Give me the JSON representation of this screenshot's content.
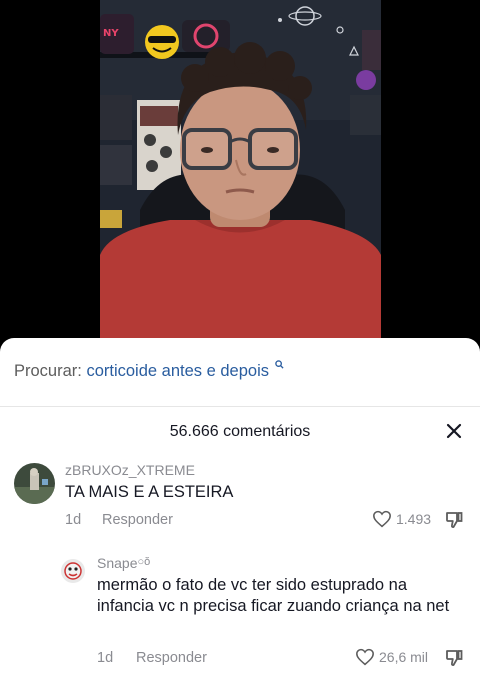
{
  "search": {
    "prefix": "Procurar:",
    "query": "corticoide antes e depois"
  },
  "comments_panel": {
    "count_label": "56.666 comentários"
  },
  "comments": [
    {
      "username": "zBRUXOz_XTREME",
      "text": "TA MAIS E A ESTEIRA",
      "time": "1d",
      "reply_label": "Responder",
      "likes": "1.493"
    },
    {
      "username": "Snape",
      "username_suffix": "○ŏ",
      "text": "mermão o fato de vc ter sido estuprado na infancia vc n precisa ficar zuando criança na net",
      "time": "1d",
      "reply_label": "Responder",
      "likes": "26,6 mil"
    }
  ],
  "colors": {
    "link_blue": "#2a5d9f",
    "muted_gray": "#8a8b91",
    "text_dark": "#161823",
    "video_wall": "#1f2530",
    "shirt_red": "#b43a36"
  },
  "icons": [
    "search-suggestion-icon",
    "close-icon",
    "heart-icon",
    "dislike-icon"
  ]
}
